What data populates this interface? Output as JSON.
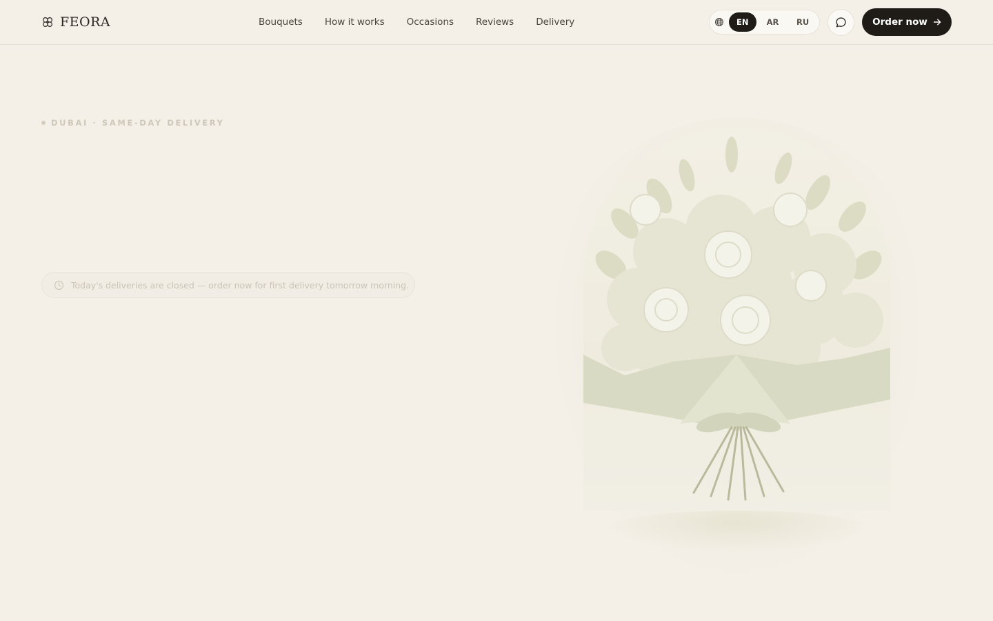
{
  "brand": {
    "name": "FEORA",
    "icon": "flower-logo-icon"
  },
  "nav": {
    "items": [
      {
        "label": "Bouquets"
      },
      {
        "label": "How it works"
      },
      {
        "label": "Occasions"
      },
      {
        "label": "Reviews"
      },
      {
        "label": "Delivery"
      }
    ]
  },
  "language": {
    "icon": "globe-icon",
    "options": [
      "EN",
      "AR",
      "RU"
    ],
    "selected": "EN"
  },
  "chat": {
    "icon": "chat-bubble-icon"
  },
  "order_button": {
    "label": "Order now",
    "icon": "arrow-right-icon"
  },
  "hero": {
    "eyebrow": "DUBAI · SAME-DAY DELIVERY",
    "notice": {
      "icon": "clock-icon",
      "text": "Today's deliveries are closed — order now for first delivery tomorrow morning."
    }
  },
  "colors": {
    "background": "#f4f0e8",
    "primary_dark": "#1f1b17",
    "muted_text": "#cbc4b6"
  }
}
